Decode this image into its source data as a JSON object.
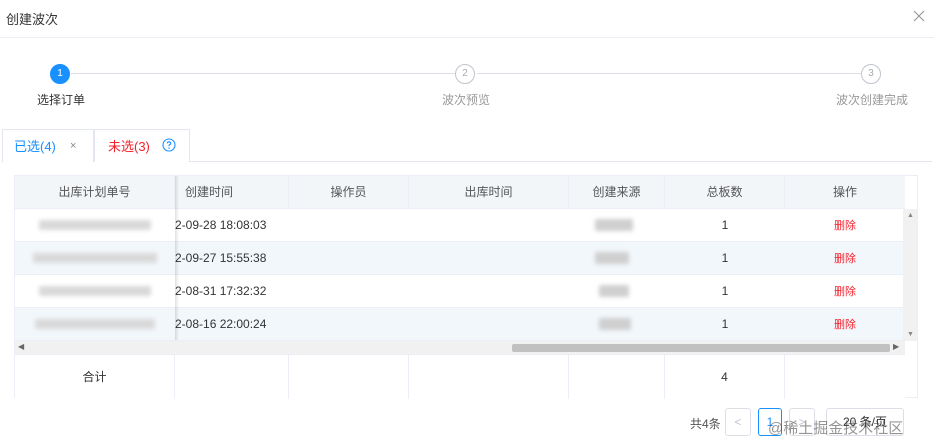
{
  "dialog": {
    "title": "创建波次"
  },
  "steps": [
    {
      "number": "1",
      "label": "选择订单",
      "state": "active"
    },
    {
      "number": "2",
      "label": "波次预览",
      "state": "inactive"
    },
    {
      "number": "3",
      "label": "波次创建完成",
      "state": "inactive"
    }
  ],
  "tabs": {
    "selected": {
      "label": "已选(4)",
      "close": "×"
    },
    "unselected": {
      "label": "未选(3)"
    }
  },
  "table": {
    "columns": [
      "出库计划单号",
      "创建时间",
      "操作员",
      "出库时间",
      "创建来源",
      "总板数",
      "操作"
    ],
    "rows": [
      {
        "created": "2-09-28 18:08:03",
        "operator": "",
        "outbound_time": "",
        "boards": "1",
        "action": "删除"
      },
      {
        "created": "2-09-27 15:55:38",
        "operator": "",
        "outbound_time": "",
        "boards": "1",
        "action": "删除"
      },
      {
        "created": "2-08-31 17:32:32",
        "operator": "",
        "outbound_time": "",
        "boards": "1",
        "action": "删除"
      },
      {
        "created": "2-08-16 22:00:24",
        "operator": "",
        "outbound_time": "",
        "boards": "1",
        "action": "删除"
      }
    ],
    "summary": {
      "label": "合计",
      "total_boards": "4"
    }
  },
  "pagination": {
    "total_text": "共4条",
    "prev": "<",
    "current_page": "1",
    "next": ">",
    "page_size": "20 条/页"
  },
  "watermark": "@稀土掘金技术社区",
  "colors": {
    "primary": "#1890ff",
    "danger": "#f5222d",
    "header_bg": "#f3f6f9",
    "stripe_bg": "#f2f7fb"
  }
}
